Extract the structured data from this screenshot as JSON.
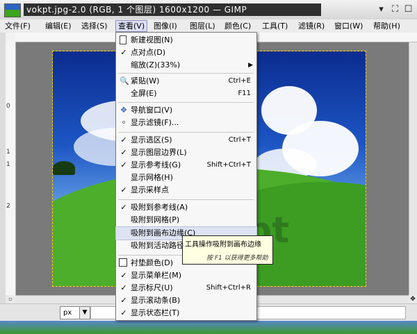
{
  "window": {
    "title": "vokpt.jpg-2.0 (RGB, 1 个图层) 1600x1200 — GIMP",
    "buttons": [
      "✕",
      "⛶",
      "☐"
    ]
  },
  "menubar": [
    {
      "label": "文件(F)"
    },
    {
      "label": "编辑(E)"
    },
    {
      "label": "选择(S)"
    },
    {
      "label": "查看(V)",
      "active": true
    },
    {
      "label": "图像(I)"
    },
    {
      "label": "图层(L)"
    },
    {
      "label": "颜色(C)"
    },
    {
      "label": "工具(T)"
    },
    {
      "label": "滤镜(R)"
    },
    {
      "label": "窗口(W)"
    },
    {
      "label": "帮助(H)"
    }
  ],
  "view_menu": {
    "items": [
      {
        "label": "新建视图(N)",
        "icon": "new-view-icon"
      },
      {
        "label": "点对点(D)",
        "check": true
      },
      {
        "label": "缩放(Z)(33%)",
        "submenu": true
      },
      {
        "sep": true
      },
      {
        "label": "紧贴(W)",
        "shortcut": "Ctrl+E",
        "icon": "zoom-icon"
      },
      {
        "label": "全屏(E)",
        "shortcut": "F11"
      },
      {
        "sep": true
      },
      {
        "label": "导航窗口(V)",
        "icon": "navigate-icon"
      },
      {
        "label": "显示滤镜(F)...",
        "icon": "filter-icon"
      },
      {
        "sep": true
      },
      {
        "label": "显示选区(S)",
        "shortcut": "Ctrl+T",
        "check": true
      },
      {
        "label": "显示图层边界(L)",
        "check": true
      },
      {
        "label": "显示参考线(G)",
        "shortcut": "Shift+Ctrl+T",
        "check": true
      },
      {
        "label": "显示网格(H)"
      },
      {
        "label": "显示采样点",
        "check": true
      },
      {
        "sep": true
      },
      {
        "label": "吸附到参考线(A)",
        "check": true
      },
      {
        "label": "吸附到网格(P)"
      },
      {
        "label": "吸附到画布边缘(C)",
        "highlight": true
      },
      {
        "label": "吸附到活动路径"
      },
      {
        "sep": true
      },
      {
        "label": "衬垫颜色(D)",
        "icon": "padding-color-icon"
      },
      {
        "label": "显示菜单栏(M)",
        "check": true
      },
      {
        "label": "显示标尺(U)",
        "shortcut": "Shift+Ctrl+R",
        "check": true
      },
      {
        "label": "显示滚动条(B)",
        "check": true
      },
      {
        "label": "显示状态栏(T)",
        "check": true
      }
    ]
  },
  "tooltip": {
    "text": "工具操作吸附到画布边缘",
    "hint": "按 F1 以获得更多帮助"
  },
  "image": {
    "watermark": "pt"
  },
  "statusbar": {
    "unit": "px"
  },
  "rulers": {
    "vertical_ticks": [
      "0",
      "1",
      "1",
      "2"
    ]
  },
  "colors": {
    "menu_highlight": "#dde3f2",
    "selection_border": "#ffd800",
    "tooltip_bg": "#ffffe1"
  }
}
